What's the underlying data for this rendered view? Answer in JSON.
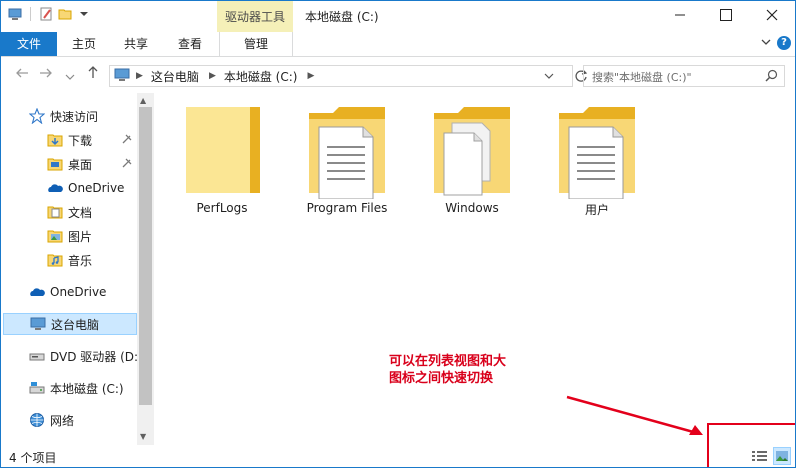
{
  "window": {
    "title": "本地磁盘 (C:)",
    "tool_tab": "驱动器工具"
  },
  "ribbon": {
    "tabs": [
      "文件",
      "主页",
      "共享",
      "查看",
      "管理"
    ],
    "help_glyph": "?"
  },
  "address": {
    "breadcrumbs": [
      "这台电脑",
      "本地磁盘 (C:)"
    ],
    "search_placeholder": "搜索\"本地磁盘 (C:)\""
  },
  "nav": {
    "items": [
      {
        "label": "快速访问",
        "icon": "star-icon"
      },
      {
        "label": "下载",
        "icon": "download-folder-icon",
        "pinned": true
      },
      {
        "label": "桌面",
        "icon": "desktop-folder-icon",
        "pinned": true
      },
      {
        "label": "OneDrive",
        "icon": "onedrive-icon"
      },
      {
        "label": "文档",
        "icon": "documents-icon"
      },
      {
        "label": "图片",
        "icon": "pictures-icon"
      },
      {
        "label": "音乐",
        "icon": "music-icon"
      },
      {
        "label": "OneDrive",
        "icon": "onedrive-icon"
      },
      {
        "label": "这台电脑",
        "icon": "computer-icon",
        "selected": true
      },
      {
        "label": "DVD 驱动器 (D:",
        "icon": "dvd-drive-icon"
      },
      {
        "label": "本地磁盘 (C:)",
        "icon": "local-disk-icon"
      },
      {
        "label": "网络",
        "icon": "network-icon"
      }
    ]
  },
  "content": {
    "items": [
      {
        "name": "PerfLogs",
        "icon": "empty-folder-icon"
      },
      {
        "name": "Program Files",
        "icon": "document-folder-icon"
      },
      {
        "name": "Windows",
        "icon": "windows-folder-icon"
      },
      {
        "name": "用户",
        "icon": "document-folder-icon"
      }
    ]
  },
  "status": {
    "count": "4 个项目"
  },
  "annotation": {
    "line1": "可以在列表视图和大",
    "line2": "图标之间快速切换",
    "color": "#d9001b"
  },
  "colors": {
    "accent": "#1979ca",
    "tool_tab_bg": "#f5f0b8",
    "selection_bg": "#cce8ff",
    "folder": "#f8d775"
  }
}
